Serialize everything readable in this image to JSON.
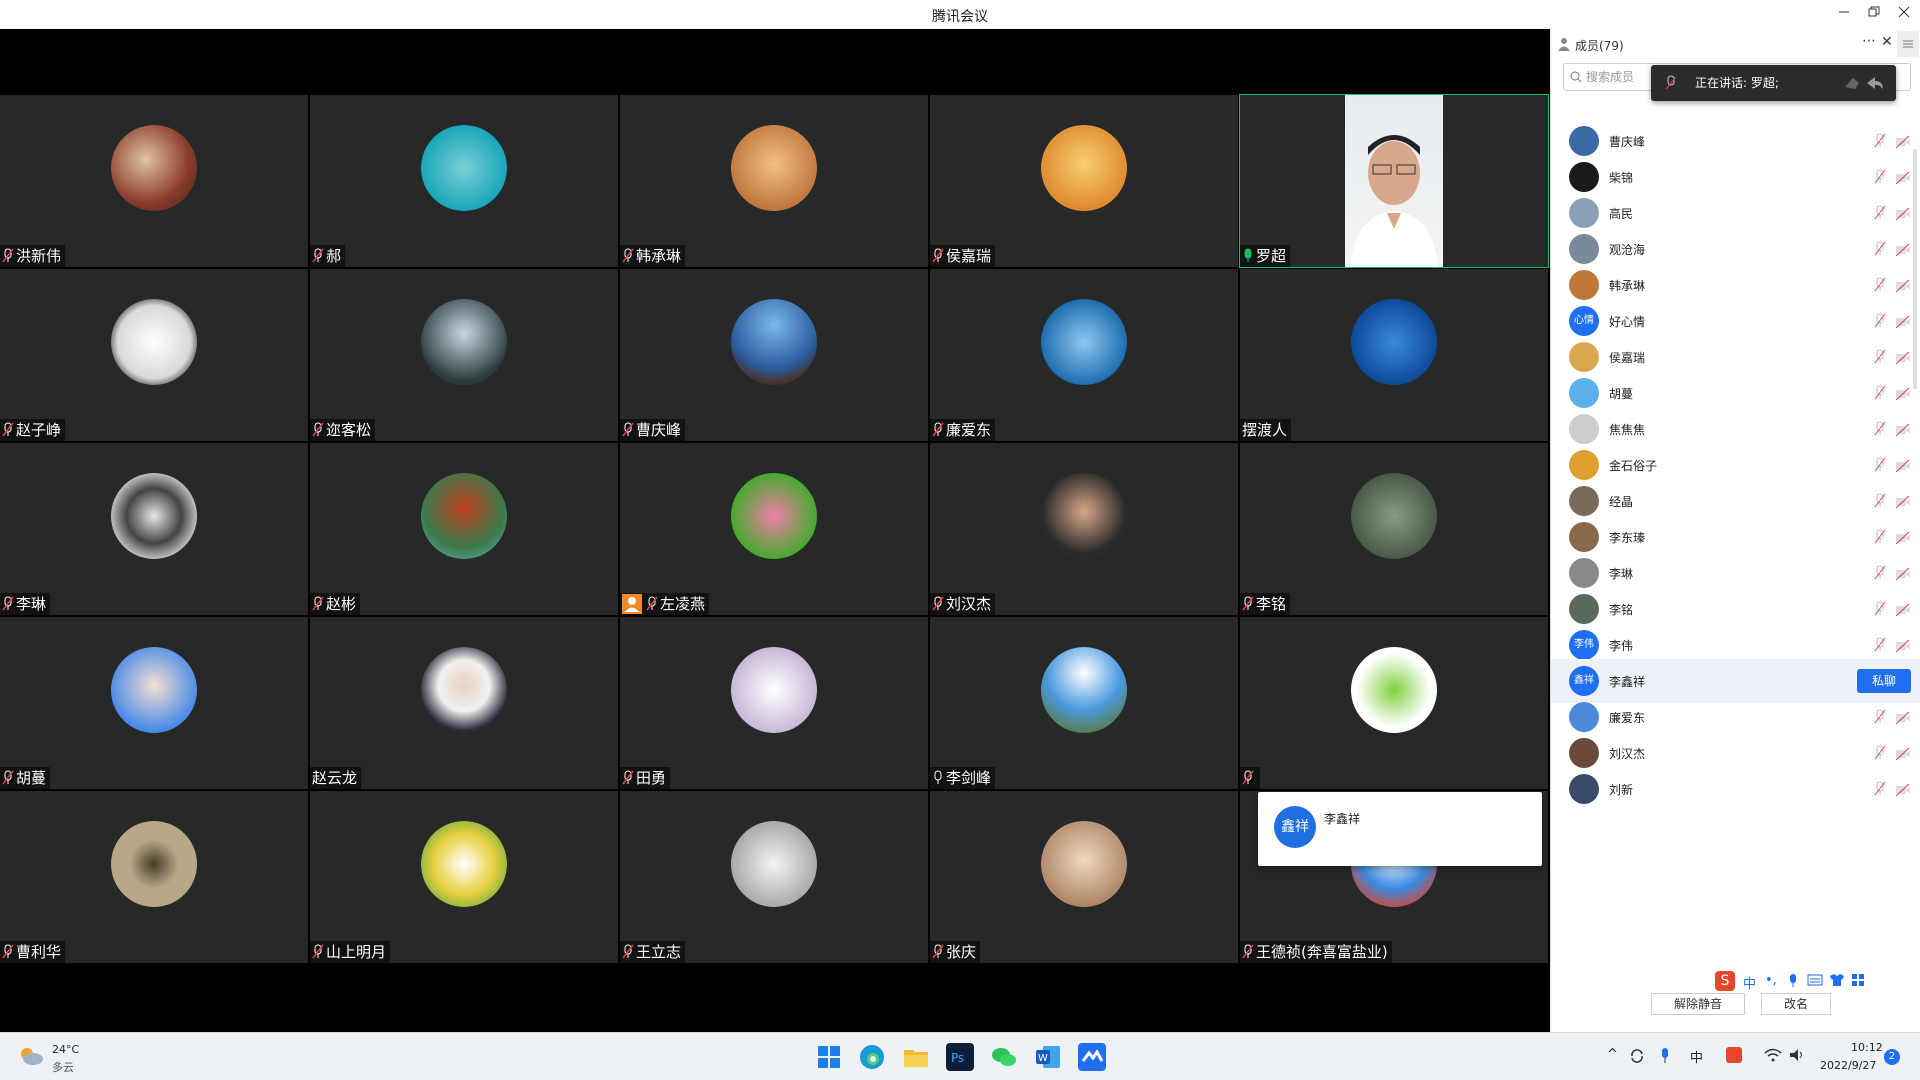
{
  "window": {
    "title": "腾讯会议",
    "minimize_icon": "minimize-icon",
    "restore_icon": "restore-icon",
    "close_icon": "close-icon"
  },
  "tiles": [
    {
      "name": "洪新伟",
      "mic": "muted"
    },
    {
      "name": "郝",
      "mic": "muted"
    },
    {
      "name": "韩承琳",
      "mic": "muted"
    },
    {
      "name": "侯嘉瑞",
      "mic": "muted"
    },
    {
      "name": "罗超",
      "mic": "speaking",
      "video": true,
      "active": true
    },
    {
      "name": "赵子峥",
      "mic": "muted"
    },
    {
      "name": "迩客松",
      "mic": "muted"
    },
    {
      "name": "曹庆峰",
      "mic": "muted"
    },
    {
      "name": "廉爱东",
      "mic": "muted"
    },
    {
      "name": "摆渡人",
      "mic": "none"
    },
    {
      "name": "李琳",
      "mic": "muted"
    },
    {
      "name": "赵彬",
      "mic": "muted"
    },
    {
      "name": "左凌燕",
      "mic": "muted",
      "host": true
    },
    {
      "name": "刘汉杰",
      "mic": "muted"
    },
    {
      "name": "李铭",
      "mic": "muted"
    },
    {
      "name": "胡蔓",
      "mic": "muted"
    },
    {
      "name": "赵云龙",
      "mic": "none"
    },
    {
      "name": "田勇",
      "mic": "muted"
    },
    {
      "name": "李剑峰",
      "mic": "on"
    },
    {
      "name": "",
      "mic": "muted"
    },
    {
      "name": "曹利华",
      "mic": "muted"
    },
    {
      "name": "山上明月",
      "mic": "muted"
    },
    {
      "name": "王立志",
      "mic": "muted"
    },
    {
      "name": "张庆",
      "mic": "muted"
    },
    {
      "name": "王德祯(奔喜富盐业)",
      "mic": "muted"
    }
  ],
  "popup": {
    "avatar_text": "鑫祥",
    "name": "李鑫祥"
  },
  "panel": {
    "title": "成员(79)",
    "more_icon": "more-icon",
    "close_icon": "close-icon",
    "search_placeholder": "搜索成员",
    "speaking_text": "正在讲话: 罗超;",
    "members": [
      {
        "name": "曹庆峰"
      },
      {
        "name": "柴锦"
      },
      {
        "name": "高民"
      },
      {
        "name": "观沧海"
      },
      {
        "name": "韩承琳"
      },
      {
        "name": "好心情",
        "avatar_text": "心情"
      },
      {
        "name": "侯嘉瑞"
      },
      {
        "name": "胡蔓"
      },
      {
        "name": "焦焦焦"
      },
      {
        "name": "金石俗子"
      },
      {
        "name": "经晶"
      },
      {
        "name": "李东瑧"
      },
      {
        "name": "李琳"
      },
      {
        "name": "李铭"
      },
      {
        "name": "李伟",
        "avatar_text": "李伟"
      },
      {
        "name": "李鑫祥",
        "avatar_text": "鑫祥",
        "selected": true
      },
      {
        "name": "廉爱东"
      },
      {
        "name": "刘汉杰"
      },
      {
        "name": "刘新"
      }
    ],
    "private_chat_label": "私聊",
    "unmute_label": "解除静音",
    "rename_label": "改名"
  },
  "taskbar": {
    "weather_temp": "24°C",
    "weather_desc": "多云",
    "time": "10:12",
    "date": "2022/9/27",
    "notification_count": "2",
    "ime_text": "中"
  },
  "colors": {
    "tile_bg": "#272828",
    "active_border": "#16c060",
    "accent": "#1f6ff0",
    "host_badge": "#f08a24"
  }
}
